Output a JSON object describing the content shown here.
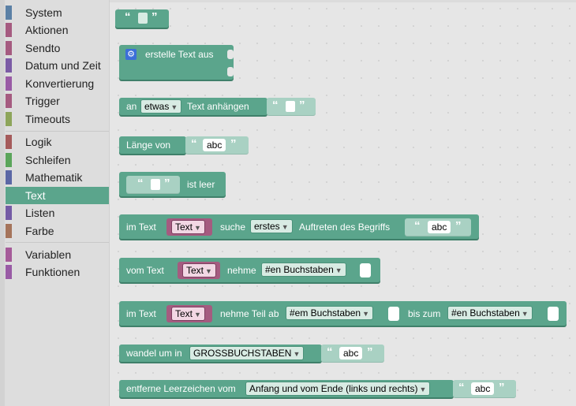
{
  "toolbox": {
    "categories": [
      {
        "label": "System",
        "color": "#5b80a5"
      },
      {
        "label": "Aktionen",
        "color": "#a55b80"
      },
      {
        "label": "Sendto",
        "color": "#a55b80"
      },
      {
        "label": "Datum und Zeit",
        "color": "#7b5ba5"
      },
      {
        "label": "Konvertierung",
        "color": "#995ba5"
      },
      {
        "label": "Trigger",
        "color": "#a55b80"
      },
      {
        "label": "Timeouts",
        "color": "#8ea55b"
      },
      {
        "label": "Logik",
        "color": "#a55b5b"
      },
      {
        "label": "Schleifen",
        "color": "#5ba55b"
      },
      {
        "label": "Mathematik",
        "color": "#5b67a5"
      },
      {
        "label": "Text",
        "color": "#5ba58c"
      },
      {
        "label": "Listen",
        "color": "#745ba5"
      },
      {
        "label": "Farbe",
        "color": "#a5745b"
      },
      {
        "label": "Variablen",
        "color": "#a55b99"
      },
      {
        "label": "Funktionen",
        "color": "#995ba5"
      }
    ],
    "selected": "Text"
  },
  "blocks": {
    "create_text": {
      "label": "erstelle Text aus"
    },
    "append": {
      "prefix": "an",
      "var": "etwas",
      "suffix": "Text anhängen"
    },
    "length": {
      "label": "Länge von",
      "value": "abc"
    },
    "isempty": {
      "label": "ist leer"
    },
    "indexof": {
      "prefix": "im Text",
      "var": "Text",
      "mid": "suche",
      "mode": "erstes",
      "suffix": "Auftreten des Begriffs",
      "value": "abc"
    },
    "charat": {
      "prefix": "vom Text",
      "var": "Text",
      "mid": "nehme",
      "mode": "#en Buchstaben"
    },
    "substring": {
      "prefix": "im Text",
      "var": "Text",
      "mid": "nehme Teil ab",
      "from": "#em Buchstaben",
      "to_label": "bis zum",
      "to": "#en Buchstaben"
    },
    "changecase": {
      "label": "wandel um in",
      "mode": "GROSSBUCHSTABEN",
      "value": "abc"
    },
    "trim": {
      "label": "entferne Leerzeichen vom",
      "mode": "Anfang und vom Ende (links und rechts)",
      "value": "abc"
    }
  },
  "colors": {
    "text_block": "#5ba58c",
    "variable_block": "#a55b80"
  }
}
